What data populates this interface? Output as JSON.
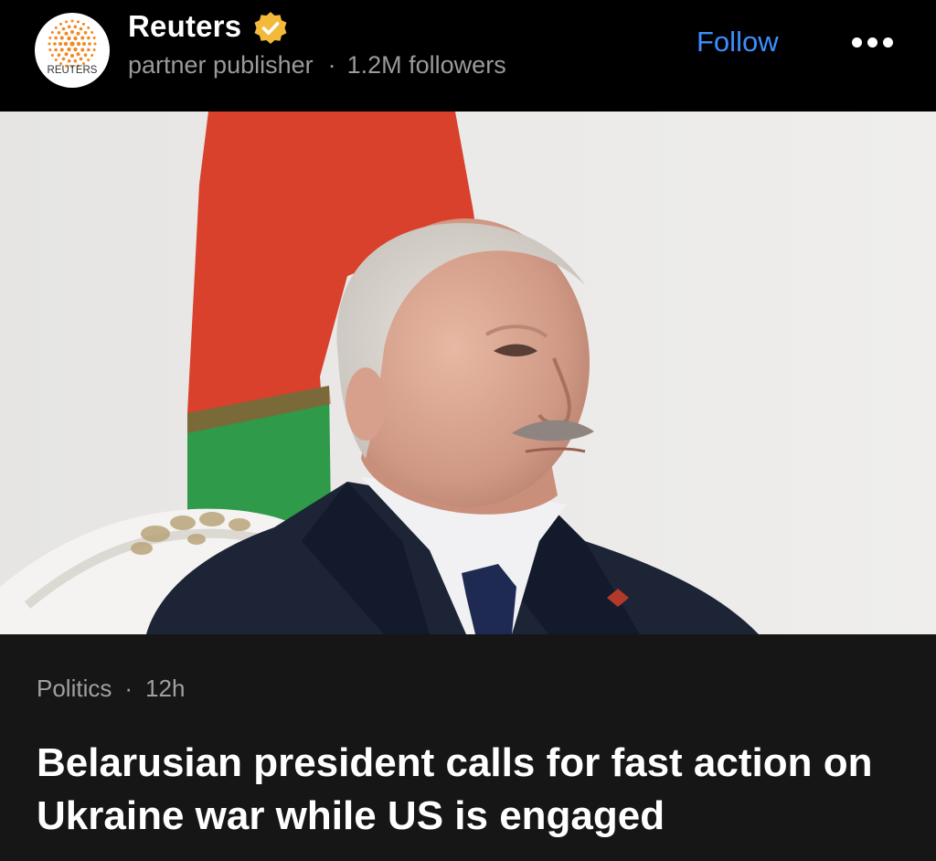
{
  "publisher": {
    "name": "Reuters",
    "logo_text": "REUTERS",
    "type": "partner publisher",
    "separator": "·",
    "followers": "1.2M followers",
    "follow_label": "Follow",
    "more_icon": "more-icon",
    "verified_icon": "verified-badge-icon",
    "accent_color": "#3d8eff",
    "badge_color": "#f2b93b"
  },
  "hero_image": {
    "description": "photo"
  },
  "article": {
    "category": "Politics",
    "separator": "·",
    "age": "12h",
    "headline": "Belarusian president calls for fast action on Ukraine war while US is engaged"
  }
}
